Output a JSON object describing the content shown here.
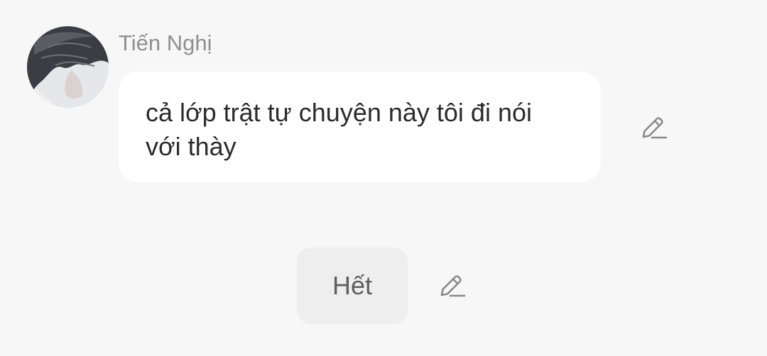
{
  "message": {
    "sender_name": "Tiến Nghị",
    "text": "cả lớp trật tự chuyện này tôi đi nói với thày",
    "avatar_icon": "user-avatar-photo",
    "edit_icon": "pencil-edit-icon"
  },
  "ending": {
    "label": "Hết",
    "edit_icon": "pencil-edit-icon"
  },
  "colors": {
    "background": "#f7f7f7",
    "bubble": "#ffffff",
    "chip": "#eeeeee",
    "name": "#8f8f8f",
    "text": "#2b2b2b",
    "icon": "#8a8a8a"
  }
}
